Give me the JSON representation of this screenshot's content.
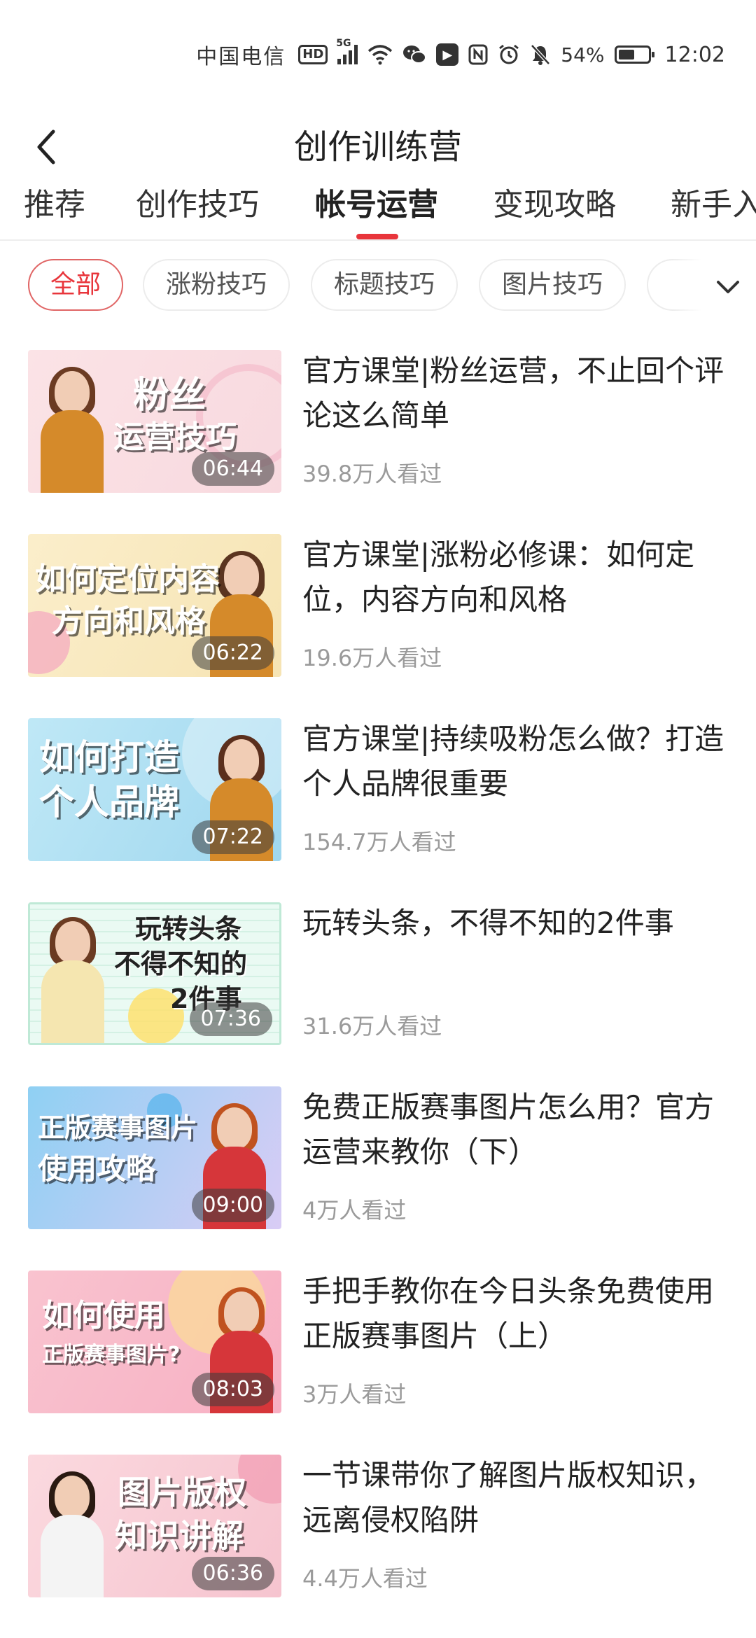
{
  "status_bar": {
    "carrier": "中国电信",
    "hd": "HD",
    "network": "5G",
    "battery_percent": "54%",
    "battery_level": 0.54,
    "time": "12:02"
  },
  "header": {
    "title": "创作训练营"
  },
  "tabs": [
    {
      "label": "推荐",
      "active": false
    },
    {
      "label": "创作技巧",
      "active": false
    },
    {
      "label": "帐号运营",
      "active": true
    },
    {
      "label": "变现攻略",
      "active": false
    },
    {
      "label": "新手入",
      "active": false
    }
  ],
  "chips": [
    {
      "label": "全部",
      "active": true
    },
    {
      "label": "涨粉技巧",
      "active": false
    },
    {
      "label": "标题技巧",
      "active": false
    },
    {
      "label": "图片技巧",
      "active": false
    },
    {
      "label": "",
      "active": false
    }
  ],
  "colors": {
    "accent": "#e8353b",
    "text": "#222222",
    "muted": "#9a9a9a"
  },
  "courses": [
    {
      "thumb_text": [
        "粉丝",
        "运营技巧"
      ],
      "duration": "06:44",
      "title": "官方课堂|粉丝运营，不止回个评论这么简单",
      "views": "39.8万人看过"
    },
    {
      "thumb_text": [
        "如何定位内容",
        "方向和风格"
      ],
      "duration": "06:22",
      "title": "官方课堂|涨粉必修课：如何定位，内容方向和风格",
      "views": "19.6万人看过"
    },
    {
      "thumb_text": [
        "如何打造",
        "个人品牌"
      ],
      "duration": "07:22",
      "title": "官方课堂|持续吸粉怎么做？打造个人品牌很重要",
      "views": "154.7万人看过"
    },
    {
      "thumb_text": [
        "玩转头条",
        "不得不知的",
        "2件事"
      ],
      "duration": "07:36",
      "title": "玩转头条，不得不知的2件事",
      "views": "31.6万人看过"
    },
    {
      "thumb_text": [
        "正版赛事图片",
        "使用攻略"
      ],
      "duration": "09:00",
      "title": "免费正版赛事图片怎么用？官方运营来教你（下）",
      "views": "4万人看过"
    },
    {
      "thumb_text": [
        "如何使用",
        "正版赛事图片?"
      ],
      "duration": "08:03",
      "title": "手把手教你在今日头条免费使用正版赛事图片（上）",
      "views": "3万人看过"
    },
    {
      "thumb_text": [
        "图片版权",
        "知识讲解"
      ],
      "duration": "06:36",
      "title": "一节课带你了解图片版权知识，远离侵权陷阱",
      "views": "4.4万人看过"
    }
  ]
}
